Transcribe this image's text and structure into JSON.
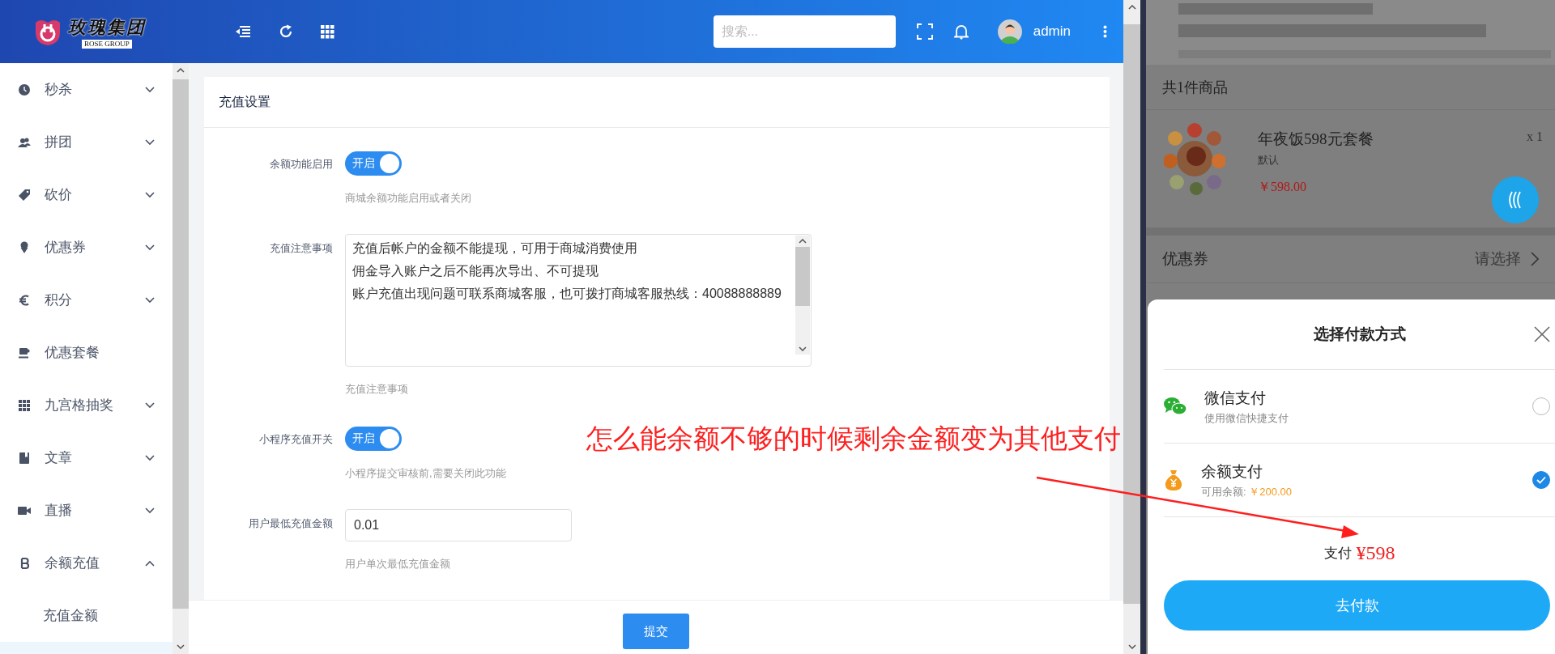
{
  "header": {
    "logo_text": "玫瑰集团",
    "logo_subtext": "ROSE GROUP",
    "search": {
      "placeholder": "搜索..."
    },
    "user": "admin"
  },
  "sidebar": {
    "items": [
      {
        "label": "秒杀",
        "kind": "submenu",
        "expanded": false
      },
      {
        "label": "拼团",
        "kind": "submenu",
        "expanded": false
      },
      {
        "label": "砍价",
        "kind": "submenu",
        "expanded": false
      },
      {
        "label": "优惠券",
        "kind": "submenu",
        "expanded": false
      },
      {
        "label": "积分",
        "kind": "submenu",
        "expanded": false
      },
      {
        "label": "优惠套餐",
        "kind": "link"
      },
      {
        "label": "九宫格抽奖",
        "kind": "submenu",
        "expanded": false
      },
      {
        "label": "文章",
        "kind": "submenu",
        "expanded": false
      },
      {
        "label": "直播",
        "kind": "submenu",
        "expanded": false
      },
      {
        "label": "余额充值",
        "kind": "submenu",
        "expanded": true,
        "children": [
          {
            "label": "充值金额",
            "selected": false
          }
        ]
      }
    ]
  },
  "form": {
    "title": "充值设置",
    "fields": [
      {
        "kind": "switch",
        "label": "余额功能启用",
        "on": true,
        "switch_text": "开启",
        "help": "商城余额功能启用或者关闭"
      },
      {
        "kind": "textarea",
        "label": "充值注意事项",
        "lines": [
          "充值后帐户的金额不能提现，可用于商城消费使用",
          "佣金导入账户之后不能再次导出、不可提现",
          "账户充值出现问题可联系商城客服，也可拨打商城客服热线：40088888889"
        ],
        "help": "充值注意事项"
      },
      {
        "kind": "switch",
        "label": "小程序充值开关",
        "on": true,
        "switch_text": "开启",
        "help": "小程序提交审核前,需要关闭此功能"
      },
      {
        "kind": "input",
        "label": "用户最低充值金额",
        "value": "0.01",
        "help": "用户单次最低充值金额"
      }
    ],
    "submit": "提交"
  },
  "mobile": {
    "count_text": "共1件商品",
    "product": {
      "name": "年夜饭598元套餐",
      "spec": "默认",
      "price": "￥598.00",
      "quantity": "x 1"
    },
    "coupon": {
      "label": "优惠券",
      "value": "请选择"
    },
    "payment_sheet": {
      "title": "选择付款方式",
      "methods": [
        {
          "kind": "wechat",
          "name": "微信支付",
          "desc": "使用微信快捷支付",
          "selected": false
        },
        {
          "kind": "balance",
          "name": "余额支付",
          "desc": "可用余额: ",
          "amount": "￥200.00",
          "selected": true
        }
      ],
      "total_label": "支付",
      "total": "¥598",
      "button": "去付款"
    }
  },
  "annotation": {
    "text": "怎么能余额不够的时候剩余金额变为其他支付"
  }
}
